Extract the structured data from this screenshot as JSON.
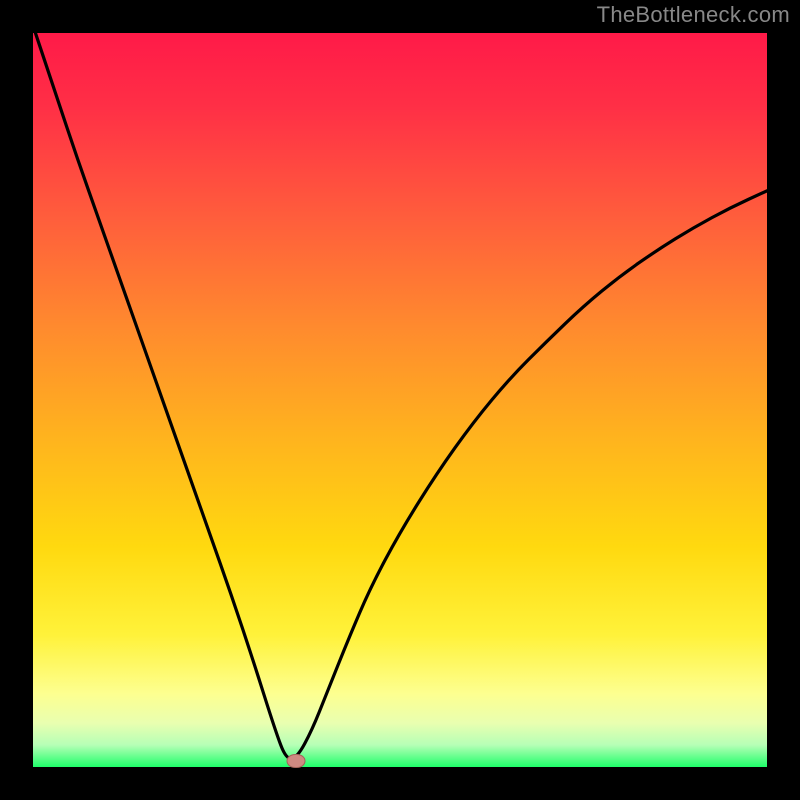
{
  "attribution": "TheBottleneck.com",
  "chart_data": {
    "type": "line",
    "title": "",
    "xlabel": "",
    "ylabel": "",
    "xlim": [
      0,
      100
    ],
    "ylim": [
      0,
      100
    ],
    "series": [
      {
        "name": "bottleneck-curve",
        "x": [
          0,
          3,
          6,
          9,
          12,
          15,
          18,
          21,
          24,
          27,
          30,
          33,
          34.5,
          36,
          38,
          40,
          43,
          46,
          50,
          55,
          60,
          65,
          70,
          75,
          80,
          85,
          90,
          95,
          100
        ],
        "values": [
          101,
          92,
          83,
          74.5,
          66,
          57.5,
          49,
          40.5,
          32,
          23.5,
          14.5,
          5,
          1,
          1.3,
          5,
          10,
          17.5,
          24.5,
          32,
          40,
          47,
          53,
          58,
          62.8,
          66.9,
          70.4,
          73.5,
          76.2,
          78.5
        ]
      }
    ],
    "marker": {
      "x": 35.8,
      "y": 0.8
    }
  }
}
